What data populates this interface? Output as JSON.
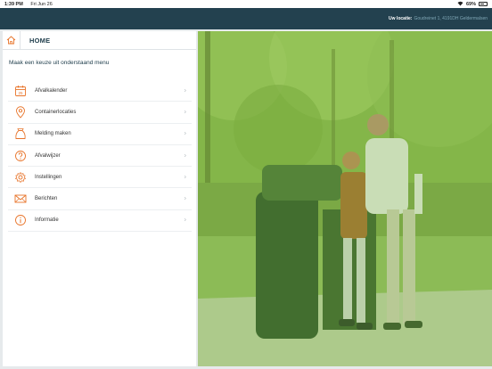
{
  "status_bar": {
    "time": "1:39 PM",
    "date": "Fri Jun 26",
    "battery_percent": "69%",
    "battery_level": 0.69
  },
  "top_bar": {
    "location_label": "Uw locatie:",
    "location_value": "Goudreinet 1, 4191DH Geldermalsen"
  },
  "panel": {
    "title": "HOME",
    "menu_heading": "Maak een keuze uit onderstaand menu",
    "items": [
      {
        "label": "Afvalkalender",
        "icon": "calendar-icon"
      },
      {
        "label": "Containerlocaties",
        "icon": "location-pin-icon"
      },
      {
        "label": "Melding maken",
        "icon": "bag-icon"
      },
      {
        "label": "Afvalwijzer",
        "icon": "question-icon"
      },
      {
        "label": "Instellingen",
        "icon": "gear-icon"
      },
      {
        "label": "Berichten",
        "icon": "envelope-icon"
      },
      {
        "label": "Informatie",
        "icon": "info-icon"
      }
    ]
  },
  "colors": {
    "accent": "#e8742a",
    "header": "#23414f",
    "photo_tint": "#7fb046"
  }
}
